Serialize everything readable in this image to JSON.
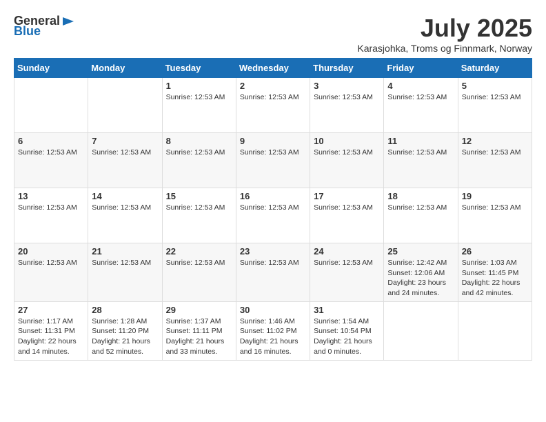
{
  "logo": {
    "general": "General",
    "blue": "Blue"
  },
  "title": "July 2025",
  "location": "Karasjohka, Troms og Finnmark, Norway",
  "days_of_week": [
    "Sunday",
    "Monday",
    "Tuesday",
    "Wednesday",
    "Thursday",
    "Friday",
    "Saturday"
  ],
  "weeks": [
    [
      {
        "day": "",
        "info": ""
      },
      {
        "day": "",
        "info": ""
      },
      {
        "day": "1",
        "info": "Sunrise: 12:53 AM"
      },
      {
        "day": "2",
        "info": "Sunrise: 12:53 AM"
      },
      {
        "day": "3",
        "info": "Sunrise: 12:53 AM"
      },
      {
        "day": "4",
        "info": "Sunrise: 12:53 AM"
      },
      {
        "day": "5",
        "info": "Sunrise: 12:53 AM"
      }
    ],
    [
      {
        "day": "6",
        "info": "Sunrise: 12:53 AM"
      },
      {
        "day": "7",
        "info": "Sunrise: 12:53 AM"
      },
      {
        "day": "8",
        "info": "Sunrise: 12:53 AM"
      },
      {
        "day": "9",
        "info": "Sunrise: 12:53 AM"
      },
      {
        "day": "10",
        "info": "Sunrise: 12:53 AM"
      },
      {
        "day": "11",
        "info": "Sunrise: 12:53 AM"
      },
      {
        "day": "12",
        "info": "Sunrise: 12:53 AM"
      }
    ],
    [
      {
        "day": "13",
        "info": "Sunrise: 12:53 AM"
      },
      {
        "day": "14",
        "info": "Sunrise: 12:53 AM"
      },
      {
        "day": "15",
        "info": "Sunrise: 12:53 AM"
      },
      {
        "day": "16",
        "info": "Sunrise: 12:53 AM"
      },
      {
        "day": "17",
        "info": "Sunrise: 12:53 AM"
      },
      {
        "day": "18",
        "info": "Sunrise: 12:53 AM"
      },
      {
        "day": "19",
        "info": "Sunrise: 12:53 AM"
      }
    ],
    [
      {
        "day": "20",
        "info": "Sunrise: 12:53 AM"
      },
      {
        "day": "21",
        "info": "Sunrise: 12:53 AM"
      },
      {
        "day": "22",
        "info": "Sunrise: 12:53 AM"
      },
      {
        "day": "23",
        "info": "Sunrise: 12:53 AM"
      },
      {
        "day": "24",
        "info": "Sunrise: 12:53 AM"
      },
      {
        "day": "25",
        "info": "Sunrise: 12:42 AM\nSunset: 12:06 AM\nDaylight: 23 hours and 24 minutes."
      },
      {
        "day": "26",
        "info": "Sunrise: 1:03 AM\nSunset: 11:45 PM\nDaylight: 22 hours and 42 minutes."
      }
    ],
    [
      {
        "day": "27",
        "info": "Sunrise: 1:17 AM\nSunset: 11:31 PM\nDaylight: 22 hours and 14 minutes."
      },
      {
        "day": "28",
        "info": "Sunrise: 1:28 AM\nSunset: 11:20 PM\nDaylight: 21 hours and 52 minutes."
      },
      {
        "day": "29",
        "info": "Sunrise: 1:37 AM\nSunset: 11:11 PM\nDaylight: 21 hours and 33 minutes."
      },
      {
        "day": "30",
        "info": "Sunrise: 1:46 AM\nSunset: 11:02 PM\nDaylight: 21 hours and 16 minutes."
      },
      {
        "day": "31",
        "info": "Sunrise: 1:54 AM\nSunset: 10:54 PM\nDaylight: 21 hours and 0 minutes."
      },
      {
        "day": "",
        "info": ""
      },
      {
        "day": "",
        "info": ""
      }
    ]
  ]
}
